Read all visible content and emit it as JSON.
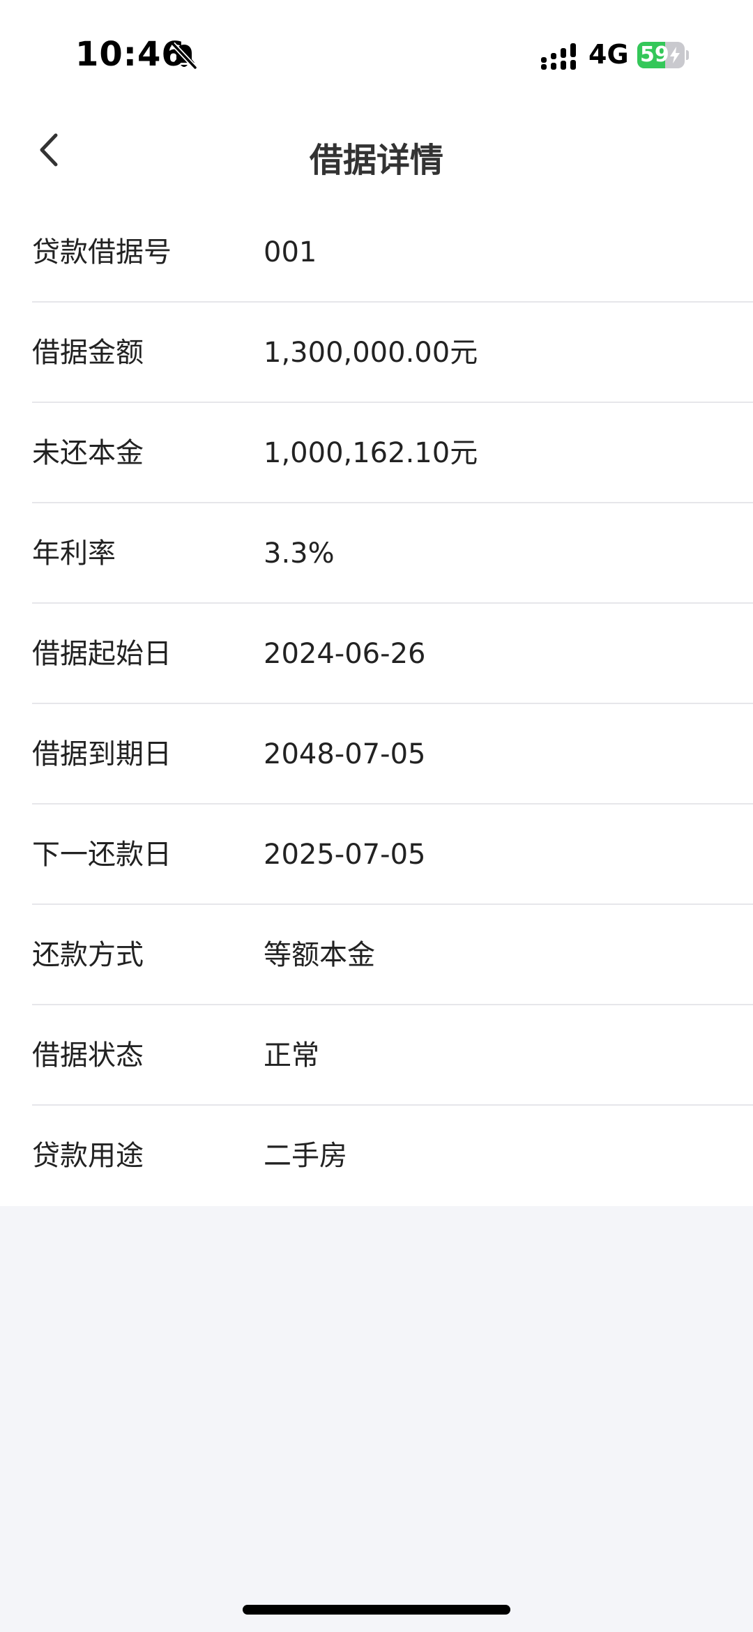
{
  "status_bar": {
    "time": "10:46",
    "network": "4G",
    "battery_level": "59",
    "battery_fraction": 0.59,
    "icons": [
      "bell-slash-icon",
      "signal-icon",
      "battery-icon",
      "charging-bolt-icon"
    ]
  },
  "nav": {
    "back_icon": "chevron-left-icon",
    "title": "借据详情"
  },
  "details": [
    {
      "label": "贷款借据号",
      "value": "001"
    },
    {
      "label": "借据金额",
      "value": "1,300,000.00元"
    },
    {
      "label": "未还本金",
      "value": "1,000,162.10元"
    },
    {
      "label": "年利率",
      "value": "3.3%"
    },
    {
      "label": "借据起始日",
      "value": "2024-06-26"
    },
    {
      "label": "借据到期日",
      "value": "2048-07-05"
    },
    {
      "label": "下一还款日",
      "value": "2025-07-05"
    },
    {
      "label": "还款方式",
      "value": "等额本金"
    },
    {
      "label": "借据状态",
      "value": "正常"
    },
    {
      "label": "贷款用途",
      "value": "二手房"
    }
  ],
  "colors": {
    "page_background": "#f4f5f9",
    "card_background": "#ffffff",
    "divider": "#e6e6ea",
    "battery_green": "#34c759"
  }
}
